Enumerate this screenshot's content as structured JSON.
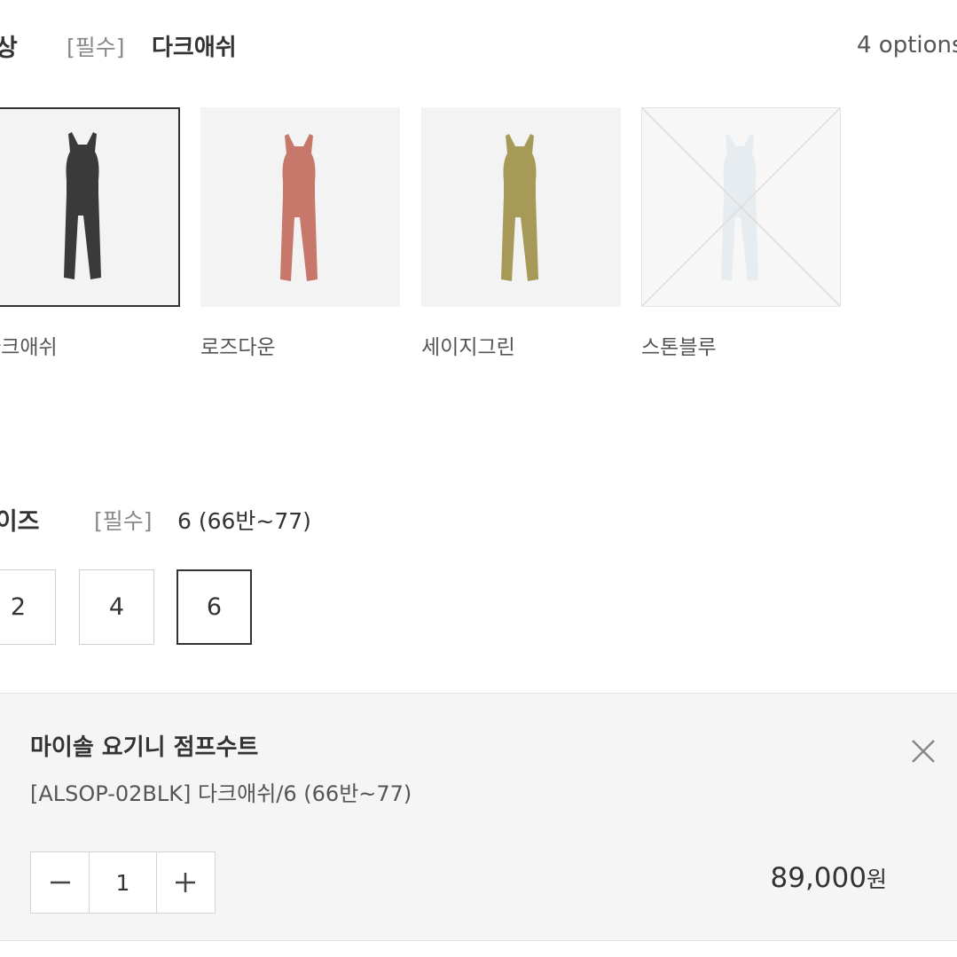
{
  "color_option": {
    "title": "색상",
    "required": "[필수]",
    "selected": "다크애쉬",
    "count": "4 options",
    "swatches": [
      {
        "label": "다크애쉬",
        "color": "#3a3a3a",
        "selected": true,
        "soldout": false
      },
      {
        "label": "로즈다운",
        "color": "#c8776b",
        "selected": false,
        "soldout": false
      },
      {
        "label": "세이지그린",
        "color": "#a79a58",
        "selected": false,
        "soldout": false
      },
      {
        "label": "스톤블루",
        "color": "#e6ecef",
        "selected": false,
        "soldout": true
      }
    ]
  },
  "size_option": {
    "title": "사이즈",
    "required": "[필수]",
    "selected": "6 (66반~77)",
    "sizes": [
      {
        "label": "2",
        "selected": false
      },
      {
        "label": "4",
        "selected": false
      },
      {
        "label": "6",
        "selected": true
      }
    ]
  },
  "selected_item": {
    "name": "마이솔 요기니 점프수트",
    "detail": "[ALSOP-02BLK] 다크애쉬/6 (66반~77)",
    "quantity": "1",
    "price": "89,000",
    "currency": "원",
    "icons": {
      "close": "close-icon",
      "minus": "minus-icon",
      "plus": "plus-icon"
    }
  }
}
